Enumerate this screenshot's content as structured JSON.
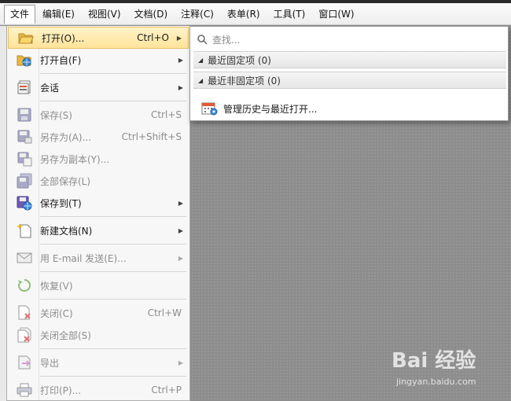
{
  "menubar": {
    "items": [
      "文件",
      "编辑(E)",
      "视图(V)",
      "文档(D)",
      "注释(C)",
      "表单(R)",
      "工具(T)",
      "窗口(W)"
    ]
  },
  "file_menu": {
    "items": [
      {
        "label": "打开(O)...",
        "shortcut": "Ctrl+O",
        "icon": "folder-open-icon"
      },
      {
        "label": "打开自(F)",
        "icon": "folder-globe-icon"
      },
      {
        "label": "会话",
        "icon": "session-icon"
      },
      {
        "label": "保存(S)",
        "shortcut": "Ctrl+S",
        "icon": "save-icon"
      },
      {
        "label": "另存为(A)...",
        "shortcut": "Ctrl+Shift+S",
        "icon": "save-as-icon"
      },
      {
        "label": "另存为副本(Y)...",
        "icon": "save-copy-icon"
      },
      {
        "label": "全部保存(L)",
        "icon": "save-all-icon"
      },
      {
        "label": "保存到(T)",
        "icon": "save-to-icon"
      },
      {
        "label": "新建文档(N)",
        "icon": "new-document-icon"
      },
      {
        "label": "用 E-mail 发送(E)...",
        "icon": "email-icon"
      },
      {
        "label": "恢复(V)",
        "icon": "revert-icon"
      },
      {
        "label": "关闭(C)",
        "shortcut": "Ctrl+W",
        "icon": "close-doc-icon"
      },
      {
        "label": "关闭全部(S)",
        "icon": "close-all-icon"
      },
      {
        "label": "导出",
        "icon": "export-icon"
      },
      {
        "label": "打印(P)...",
        "shortcut": "Ctrl+P",
        "icon": "print-icon"
      }
    ]
  },
  "submenu": {
    "search_placeholder": "查找...",
    "pinned_label": "最近固定项 (0)",
    "unpinned_label": "最近非固定项 (0)",
    "manage_label": "管理历史与最近打开..."
  },
  "watermark": {
    "main": "Bai 经验",
    "sub": "jingyan.baidu.com"
  }
}
